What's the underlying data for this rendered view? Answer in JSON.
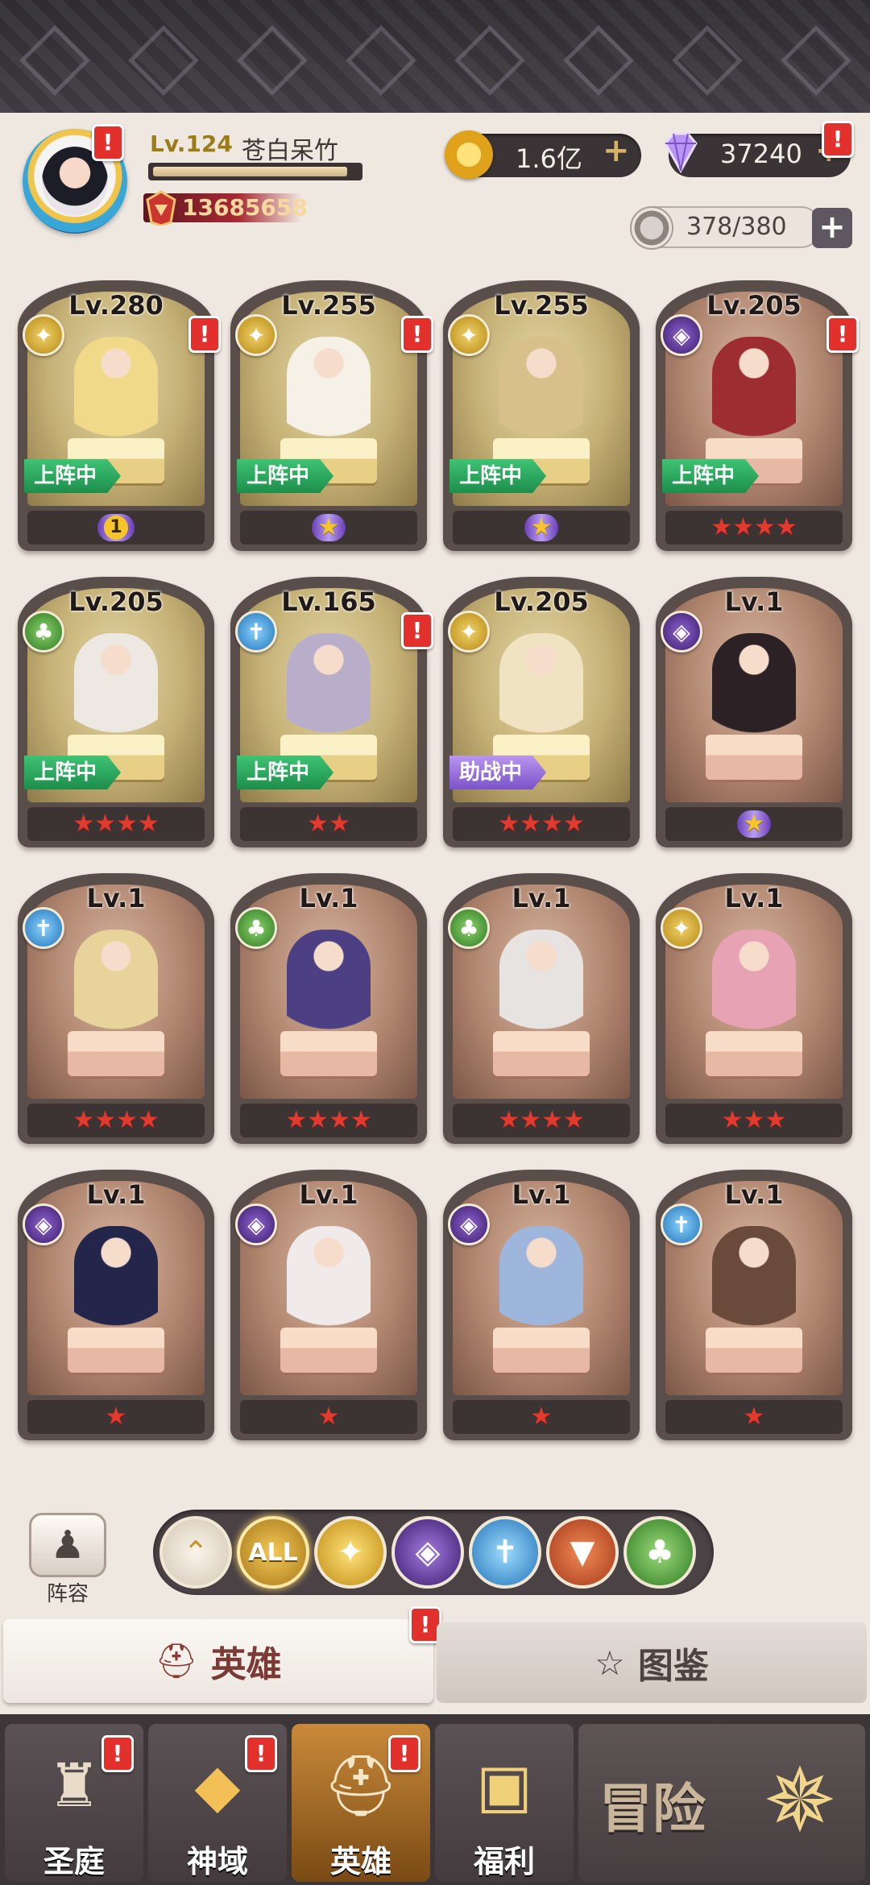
{
  "player": {
    "level": "Lv.124",
    "name": "苍白呆竹",
    "power": "13685658",
    "exp_progress": 0.95
  },
  "currency": {
    "gold": "1.6亿",
    "gems": "37240",
    "stamina": "378/380",
    "plus": "+"
  },
  "alert": "!",
  "heroes": [
    {
      "level": "Lv.280",
      "faction": "light",
      "status": "上阵中",
      "stars": "1"
    },
    {
      "level": "Lv.255",
      "faction": "light",
      "status": "上阵中",
      "stars": "★"
    },
    {
      "level": "Lv.255",
      "faction": "light",
      "status": "上阵中",
      "stars": "★"
    },
    {
      "level": "Lv.205",
      "faction": "dark",
      "status": "上阵中",
      "stars": "★★★★"
    },
    {
      "level": "Lv.205",
      "faction": "nature",
      "status": "上阵中",
      "stars": "★★★★"
    },
    {
      "level": "Lv.165",
      "faction": "holy",
      "status": "上阵中",
      "stars": "★★"
    },
    {
      "level": "Lv.205",
      "faction": "light",
      "status": "助战中",
      "stars": "★★★★"
    },
    {
      "level": "Lv.1",
      "faction": "dark",
      "status": "",
      "stars": "★"
    },
    {
      "level": "Lv.1",
      "faction": "holy",
      "status": "",
      "stars": "★★★★"
    },
    {
      "level": "Lv.1",
      "faction": "nature",
      "status": "",
      "stars": "★★★★"
    },
    {
      "level": "Lv.1",
      "faction": "nature",
      "status": "",
      "stars": "★★★★"
    },
    {
      "level": "Lv.1",
      "faction": "light",
      "status": "",
      "stars": "★★★"
    },
    {
      "level": "Lv.1",
      "faction": "dark",
      "status": "",
      "stars": "★"
    },
    {
      "level": "Lv.1",
      "faction": "dark",
      "status": "",
      "stars": "★"
    },
    {
      "level": "Lv.1",
      "faction": "dark",
      "status": "",
      "stars": "★"
    },
    {
      "level": "Lv.1",
      "faction": "holy",
      "status": "",
      "stars": "★"
    }
  ],
  "filters": {
    "lineup_label": "阵容",
    "all_label": "ALL"
  },
  "tabs": {
    "hero": "英雄",
    "collection": "图鉴"
  },
  "nav": {
    "sanctuary": "圣庭",
    "divine": "神域",
    "hero": "英雄",
    "welfare": "福利",
    "adventure": "冒险"
  },
  "colors": {
    "star_red": "#e23a2f",
    "star_gold": "#f5c52a",
    "tag_green": "#2aa85c",
    "tag_purple": "#8e66d6",
    "alert_red": "#e2302d"
  }
}
